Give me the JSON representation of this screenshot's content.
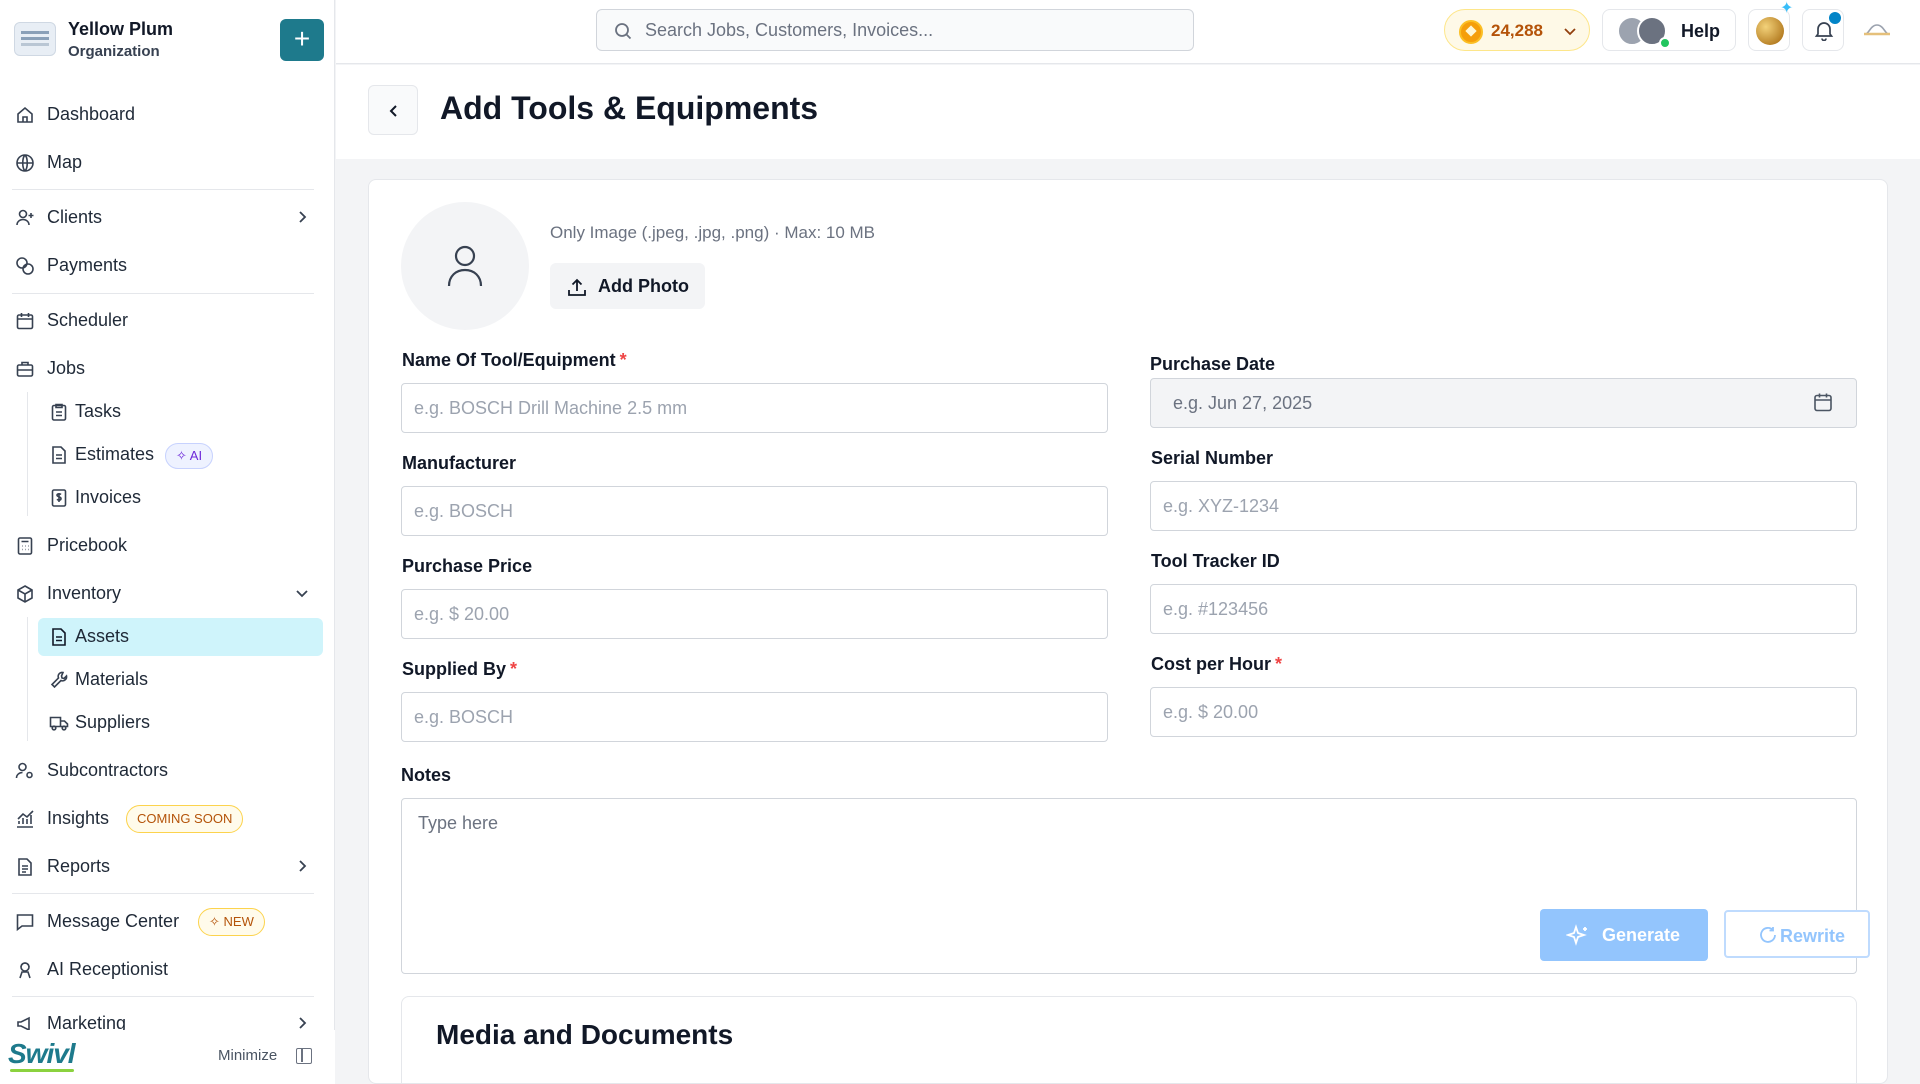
{
  "org": {
    "name": "Yellow Plum",
    "subtitle": "Organization",
    "add_label": "+"
  },
  "sidebar": {
    "dashboard": "Dashboard",
    "map": "Map",
    "clients": "Clients",
    "payments": "Payments",
    "scheduler": "Scheduler",
    "jobs": "Jobs",
    "tasks": "Tasks",
    "estimates": "Estimates",
    "estimates_badge": "✧ AI",
    "invoices": "Invoices",
    "pricebook": "Pricebook",
    "inventory": "Inventory",
    "assets": "Assets",
    "materials": "Materials",
    "suppliers": "Suppliers",
    "subcontractors": "Subcontractors",
    "insights": "Insights",
    "insights_badge": "COMING SOON",
    "reports": "Reports",
    "message_center": "Message Center",
    "message_badge": "✧ NEW",
    "ai_receptionist": "AI Receptionist",
    "marketing": "Marketing",
    "brand": "Swivl",
    "minimize": "Minimize"
  },
  "topbar": {
    "search_placeholder": "Search Jobs, Customers, Invoices...",
    "coins": "24,288",
    "help": "Help"
  },
  "page": {
    "title": "Add Tools & Equipments"
  },
  "photo": {
    "hint": "Only Image (.jpeg, .jpg, .png) · Max: 10 MB",
    "button": "Add Photo"
  },
  "form": {
    "name_label": "Name Of Tool/Equipment",
    "name_placeholder": "e.g. BOSCH Drill Machine 2.5 mm",
    "purchase_date_label": "Purchase Date",
    "purchase_date_placeholder": "e.g. Jun 27, 2025",
    "manufacturer_label": "Manufacturer",
    "manufacturer_placeholder": "e.g. BOSCH",
    "serial_label": "Serial Number",
    "serial_placeholder": "e.g. XYZ-1234",
    "price_label": "Purchase Price",
    "price_placeholder": "e.g. $ 20.00",
    "tracker_label": "Tool Tracker ID",
    "tracker_placeholder": "e.g. #123456",
    "supplied_label": "Supplied By",
    "supplied_placeholder": "e.g. BOSCH",
    "cost_label": "Cost per Hour",
    "cost_placeholder": "e.g. $ 20.00",
    "required_mark": "*",
    "notes_label": "Notes",
    "notes_placeholder": "Type here",
    "generate": "Generate",
    "rewrite": "Rewrite"
  },
  "media": {
    "title": "Media and Documents"
  },
  "colors": {
    "brand": "#1e7a8c",
    "active_bg": "#cff4fb",
    "required": "#ef4444",
    "accent_soft": "#93c5fd"
  }
}
